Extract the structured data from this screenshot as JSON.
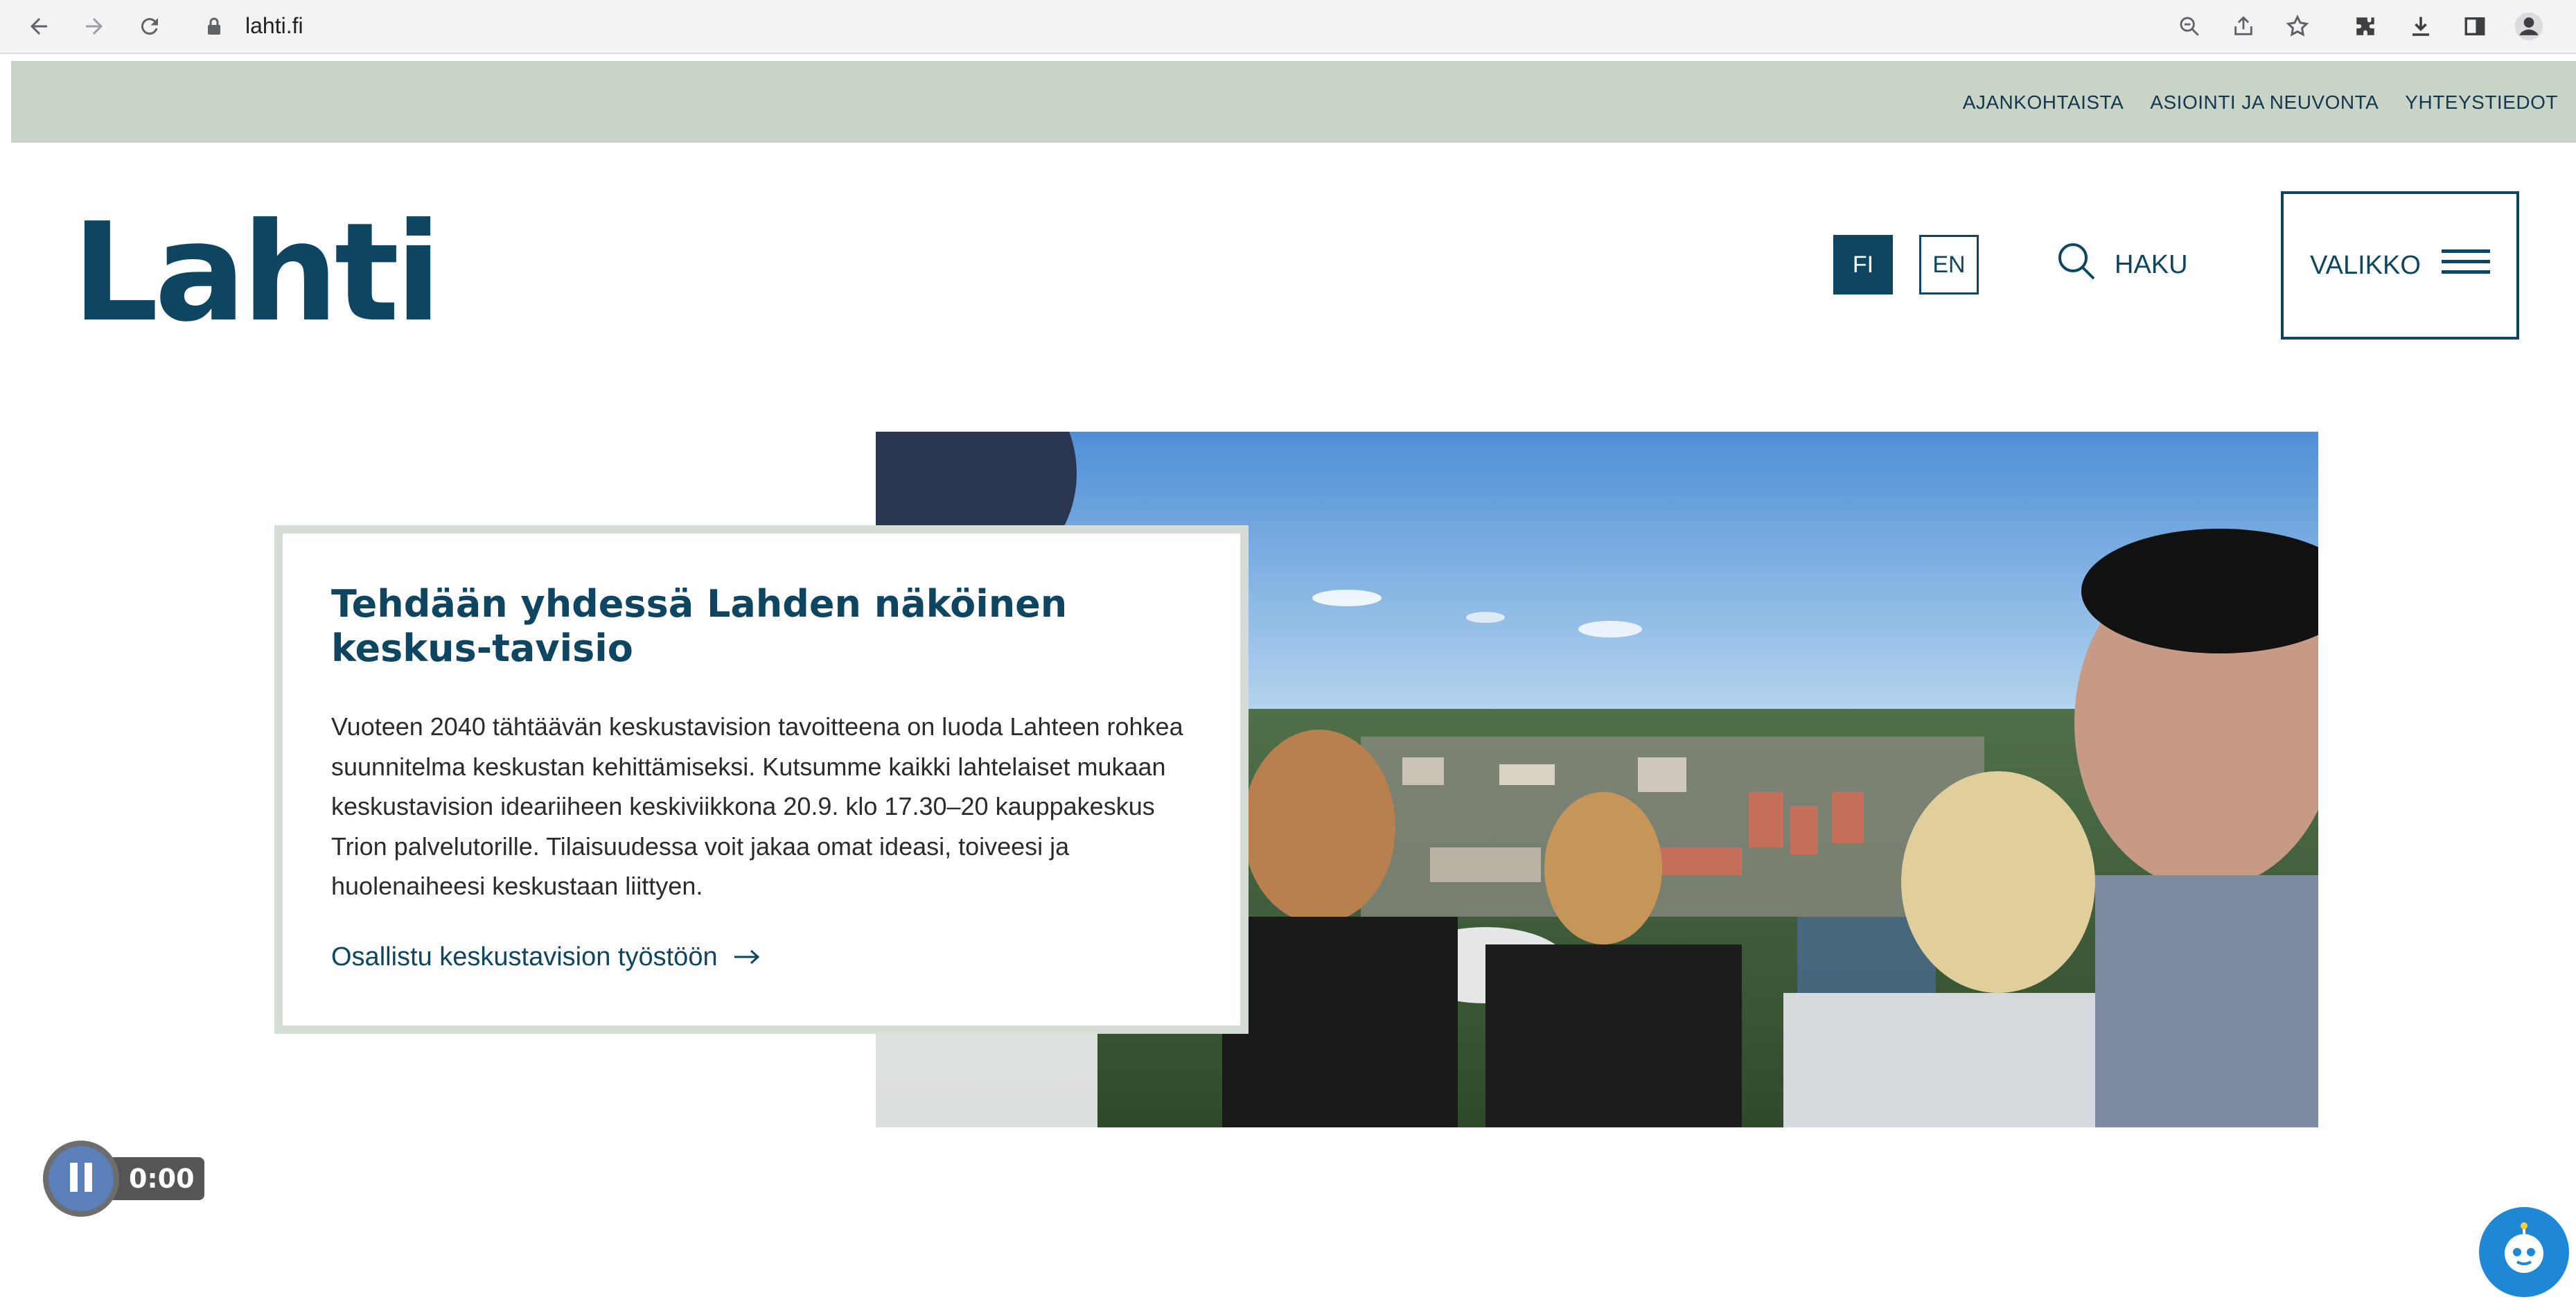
{
  "browser": {
    "url": "lahti.fi"
  },
  "utility_nav": [
    {
      "label": "AJANKOHTAISTA"
    },
    {
      "label": "ASIOINTI JA NEUVONTA"
    },
    {
      "label": "YHTEYSTIEDOT"
    }
  ],
  "header": {
    "logo": "Lahti",
    "lang_fi": "FI",
    "lang_en": "EN",
    "search_label": "HAKU",
    "menu_label": "VALIKKO"
  },
  "hero": {
    "title": "Tehdään yhdessä Lahden näköinen keskus-tavisio",
    "body": "Vuoteen 2040 tähtäävän keskustavision tavoitteena on luoda Lahteen rohkea suunnitelma keskustan kehittämiseksi. Kutsumme kaikki lahtelaiset mukaan keskustavision ideariiheen keskiviikkona 20.9. klo 17.30–20 kauppakeskus Trion palvelutorille. Tilaisuudessa voit jakaa omat ideasi, toiveesi ja huolenaiheesi keskustaan liittyen.",
    "cta": "Osallistu keskustavision työstöön"
  },
  "video": {
    "time": "0:00"
  },
  "colors": {
    "brand": "#0e4560",
    "utility_bar": "#c7d4c6",
    "card_border": "#d6ddd7"
  }
}
